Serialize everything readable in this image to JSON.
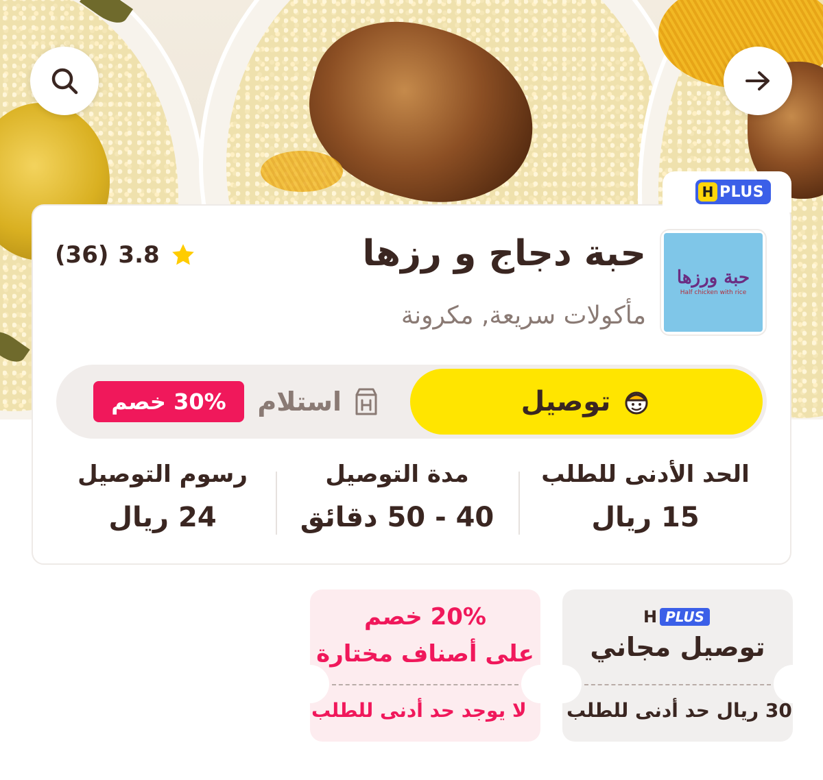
{
  "header": {
    "search_icon": "search-icon",
    "back_icon": "arrow-right-icon"
  },
  "restaurant": {
    "badge": {
      "h": "H",
      "plus": "PLUS"
    },
    "logo_text": "حبة ورزها",
    "logo_subtext": "Half chicken with rice",
    "name": "حبة دجاج و رزها",
    "cuisines": "مأكولات سريعة, مكرونة",
    "rating": "3.8",
    "rating_count": "(36)"
  },
  "order_mode": {
    "delivery_label": "توصيل",
    "pickup_label": "استلام",
    "pickup_discount": "30% خصم",
    "selected": "delivery"
  },
  "stats": {
    "min_order_label": "الحد الأدنى للطلب",
    "min_order_value": "15 ريال",
    "delivery_time_label": "مدة التوصيل",
    "delivery_time_value": "40 - 50 دقائق",
    "delivery_fee_label": "رسوم التوصيل",
    "delivery_fee_value": "24 ريال"
  },
  "offers": [
    {
      "badge": {
        "h": "H",
        "plus": "PLUS"
      },
      "title": "توصيل مجاني",
      "condition": "30 ريال حد أدنى للطلب"
    },
    {
      "title": "20% خصم",
      "subtitle": "على أصناف مختارة",
      "condition": "لا يوجد حد أدنى للطلب"
    }
  ],
  "colors": {
    "accent_yellow": "#ffe500",
    "discount_pink": "#f0185b",
    "plus_blue": "#3b5fe8",
    "text_dark": "#3a2621",
    "text_muted": "#8a7a74"
  }
}
